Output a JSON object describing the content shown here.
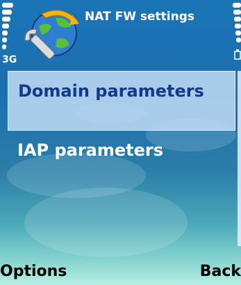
{
  "header": {
    "title": "NAT FW settings",
    "network": "3G",
    "signal_level": 7,
    "battery_level": 7
  },
  "menu": {
    "items": [
      {
        "label": "Domain parameters",
        "selected": true
      },
      {
        "label": "IAP parameters",
        "selected": false
      }
    ]
  },
  "softkeys": {
    "left": "Options",
    "right": "Back"
  },
  "colors": {
    "selection_text": "#133a86",
    "selection_bg": "#c1dcf5",
    "background_top": "#1a74b6",
    "background_bottom": "#b7eee4"
  },
  "icons": {
    "app": "settings-wrench-globe-icon",
    "signal": "signal-strength-icon",
    "battery": "battery-icon",
    "charging": "charging-icon"
  }
}
